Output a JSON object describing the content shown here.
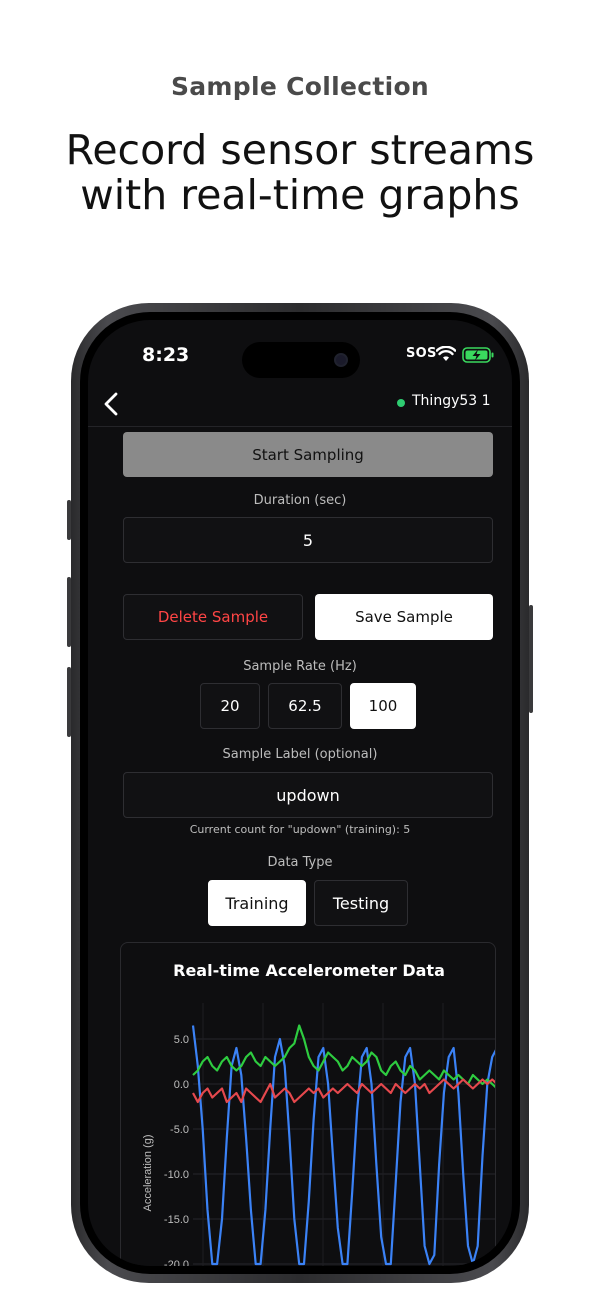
{
  "promo": {
    "kicker": "Sample Collection",
    "headline": "Record sensor streams with real-time graphs"
  },
  "status_bar": {
    "time": "8:23",
    "sos": "SOS"
  },
  "nav": {
    "device_name": "Thingy53 1"
  },
  "controls": {
    "start_label": "Start Sampling",
    "duration_label": "Duration (sec)",
    "duration_value": "5",
    "delete_label": "Delete Sample",
    "save_label": "Save Sample",
    "rate_label": "Sample Rate (Hz)",
    "rates": [
      "20",
      "62.5",
      "100"
    ],
    "selected_rate": "100",
    "label_label": "Sample Label (optional)",
    "label_value": "updown",
    "count_text": "Current count for \"updown\" (training): 5",
    "data_type_label": "Data Type",
    "data_types": [
      "Training",
      "Testing"
    ],
    "selected_type": "Training"
  },
  "colors": {
    "series_x": "#e5484d",
    "series_y": "#2ecc40",
    "series_z": "#3b82f6",
    "connected": "#2ecc71",
    "delete": "#ff4545"
  },
  "chart_data": {
    "type": "line",
    "title": "Real-time Accelerometer Data",
    "ylabel": "Acceleration (g)",
    "xlabel": "",
    "yticks": [
      "5.0",
      "0.0",
      "-5.0",
      "-10.0",
      "-15.0",
      "-20.0"
    ],
    "ylim": [
      -20,
      7
    ],
    "grid": true,
    "series": [
      {
        "color": "#3b82f6",
        "values": [
          6.5,
          2,
          -5,
          -14,
          -20,
          -20,
          -15,
          -6,
          2,
          4,
          1,
          -6,
          -14,
          -20,
          -20,
          -14,
          -5,
          3,
          5,
          2,
          -6,
          -15,
          -20,
          -20,
          -13,
          -4,
          3,
          4,
          0,
          -8,
          -16,
          -20,
          -20,
          -12,
          -3,
          3,
          4,
          0,
          -9,
          -17,
          -20,
          -20,
          -11,
          -2,
          3,
          4,
          0,
          -9,
          -18,
          -20,
          -19,
          -9,
          -1,
          3,
          4,
          -1,
          -10,
          -18,
          -20,
          -18,
          -8,
          0,
          3,
          4
        ]
      },
      {
        "color": "#2ecc40",
        "values": [
          1,
          1.5,
          2.5,
          3,
          2,
          1.5,
          2.5,
          3,
          2,
          1.5,
          2,
          3,
          3.5,
          2.5,
          2,
          3,
          2.5,
          2,
          2.5,
          3,
          4,
          4.5,
          6.5,
          5,
          3,
          2,
          1.5,
          2.5,
          3.5,
          3,
          2.5,
          1.5,
          2,
          3,
          2.5,
          2,
          2.5,
          3.5,
          3,
          1.5,
          1,
          2,
          2.5,
          1.5,
          1,
          2,
          1.5,
          0.5,
          1,
          1.5,
          1,
          0.5,
          1.5,
          1,
          0.5,
          1,
          0.5,
          0,
          1,
          0.5,
          0,
          0.5,
          0,
          -0.5
        ]
      },
      {
        "color": "#e5484d",
        "values": [
          -1,
          -2,
          -1,
          -0.5,
          -1.5,
          -1,
          -0.5,
          -2,
          -1.5,
          -1,
          -2,
          -0.5,
          -1,
          -1.5,
          -2,
          -1,
          0,
          -1.5,
          -1,
          -0.5,
          -1,
          -2,
          -1.5,
          -1,
          -0.5,
          -1,
          -0.5,
          -1.5,
          -1,
          -0.5,
          -1,
          -0.5,
          0,
          -0.5,
          -1,
          0,
          -0.5,
          -1,
          -0.5,
          0,
          -0.5,
          -1,
          0,
          -0.5,
          -1,
          -0.5,
          0,
          -0.5,
          0,
          -1,
          -0.5,
          0,
          0.5,
          0,
          -0.5,
          0,
          0.5,
          0,
          -0.5,
          0,
          0.5,
          0,
          0.5,
          0
        ]
      }
    ]
  }
}
